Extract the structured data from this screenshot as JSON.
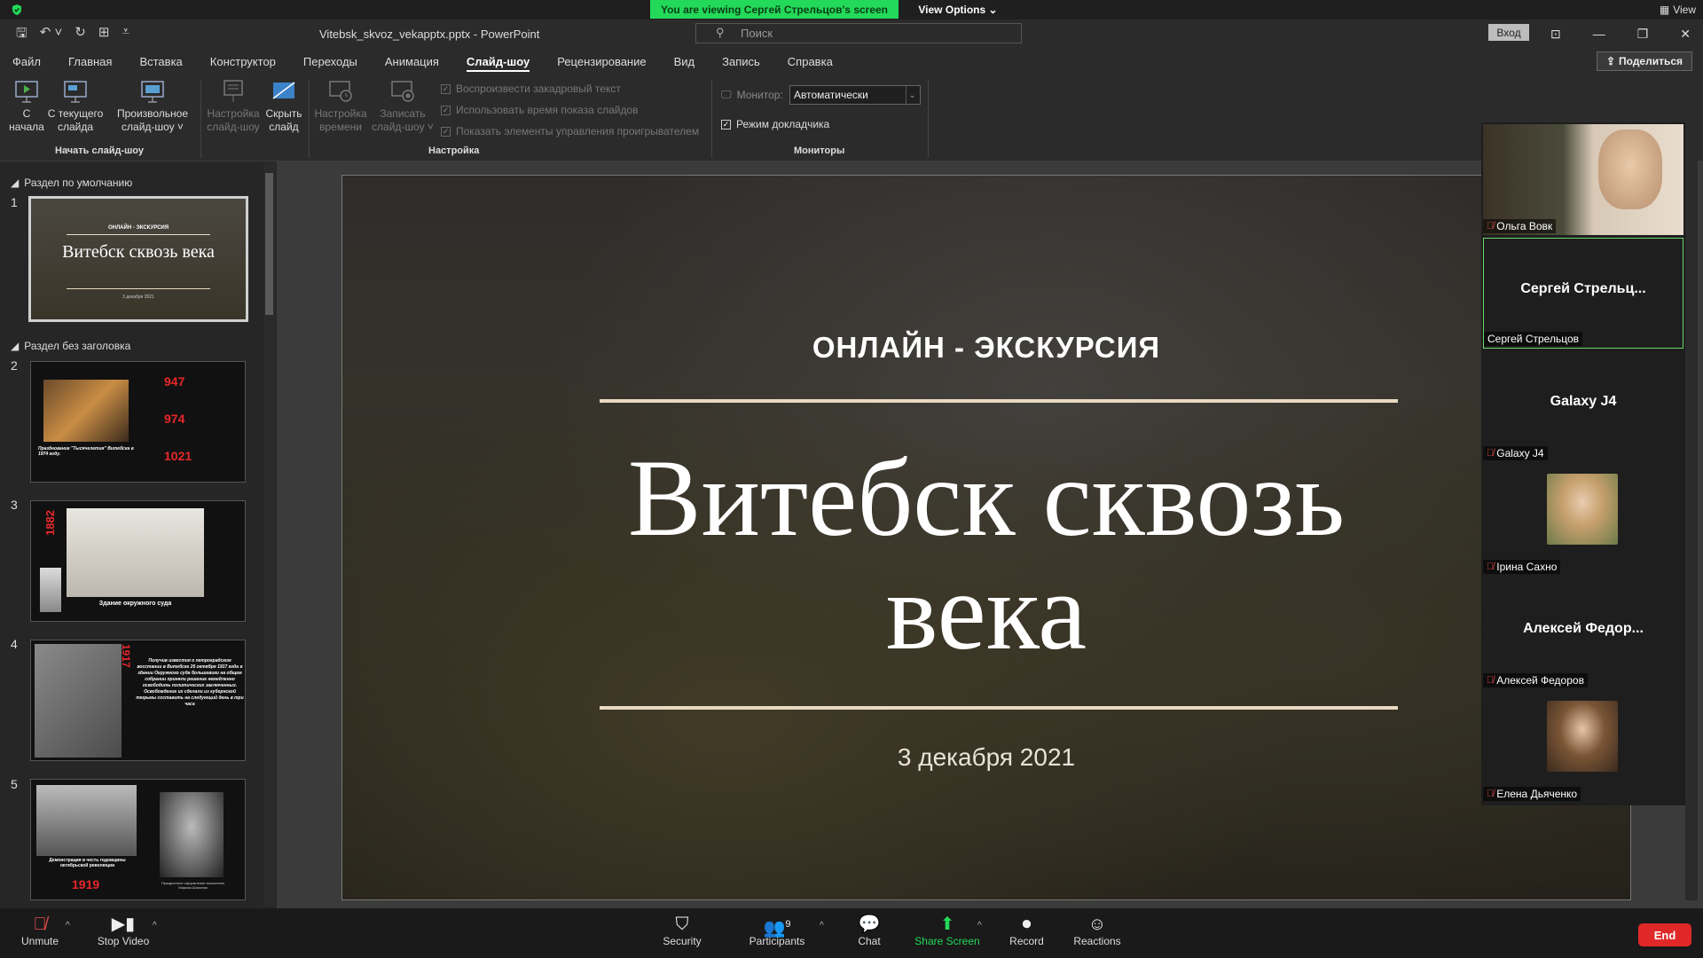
{
  "zoom": {
    "viewing_banner": "You are viewing Сергей Стрельцов's screen",
    "view_options": "View Options",
    "view_label": "View",
    "toolbar": {
      "unmute": "Unmute",
      "stop_video": "Stop Video",
      "security": "Security",
      "participants": "Participants",
      "participants_count": "9",
      "chat": "Chat",
      "share_screen": "Share Screen",
      "record": "Record",
      "reactions": "Reactions",
      "end": "End"
    },
    "participants": [
      {
        "name": "Ольга Вовк",
        "muted": true,
        "video": true
      },
      {
        "name": "Сергей Стрельцов",
        "display": "Сергей  Стрельц...",
        "muted": false,
        "video": false,
        "active": true
      },
      {
        "name": "Galaxy J4",
        "display": "Galaxy J4",
        "muted": true,
        "video": false
      },
      {
        "name": "Ірина Сахно",
        "muted": true,
        "video": true
      },
      {
        "name": "Алексей Федоров",
        "display": "Алексей  Федор...",
        "muted": true,
        "video": false
      },
      {
        "name": "Елена Дьяченко",
        "muted": true,
        "video": true
      }
    ]
  },
  "ppt": {
    "doc_title": "Vitebsk_skvoz_vekapptx.pptx  -  PowerPoint",
    "search_placeholder": "Поиск",
    "login": "Вход",
    "share": "Поделиться",
    "menu": [
      "Файл",
      "Главная",
      "Вставка",
      "Конструктор",
      "Переходы",
      "Анимация",
      "Слайд-шоу",
      "Рецензирование",
      "Вид",
      "Запись",
      "Справка"
    ],
    "active_menu": "Слайд-шоу",
    "ribbon": {
      "from_start": [
        "С",
        "начала"
      ],
      "from_current": [
        "С текущего",
        "слайда"
      ],
      "custom": [
        "Произвольное",
        "слайд-шоу ˅"
      ],
      "setup": [
        "Настройка",
        "слайд-шоу"
      ],
      "hide": [
        "Скрыть",
        "слайд"
      ],
      "rehearse": [
        "Настройка",
        "времени"
      ],
      "record": [
        "Записать",
        "слайд-шоу ˅"
      ],
      "group_start": "Начать слайд-шоу",
      "group_setup": "Настройка",
      "group_monitors": "Мониторы",
      "chk_narration": "Воспроизвести закадровый текст",
      "chk_timings": "Использовать время показа слайдов",
      "chk_controls": "Показать элементы управления проигрывателем",
      "monitor_label": "Монитор:",
      "monitor_value": "Автоматически",
      "presenter_view": "Режим докладчика"
    },
    "sections": {
      "default": "Раздел по умолчанию",
      "untitled": "Раздел без заголовка"
    },
    "thumbnails": [
      {
        "num": "1",
        "kicker": "ОНЛАЙН - ЭКСКУРСИЯ",
        "title": "Витебск сквозь века",
        "date": "3 декабря 2021"
      },
      {
        "num": "2",
        "years": [
          "947",
          "974",
          "1021"
        ],
        "caption": "Празднование \"Тысячелетия\" Витебска в 1974 году."
      },
      {
        "num": "3",
        "year": "1882",
        "caption": "Здание окружного суда"
      },
      {
        "num": "4",
        "year": "1917",
        "text": "Получив известия о петроградском восстании в Витебске 26 октября 1917 года в здании Окружного суда большевики на общем собрании приняли решение немедленно освободить политических заключенных. Освобождение их сделали из губернской тюрьмы составить на следующий день в три часа"
      },
      {
        "num": "5",
        "year": "1919",
        "caption": "Демонстрация в честь годовщины октябрьской революции",
        "caption2": "Праздничное оформление выполнено Марком Шагалом"
      }
    ],
    "slide": {
      "kicker": "ОНЛАЙН - ЭКСКУРСИЯ",
      "title_line1": "Витебск сквозь",
      "title_line2": "века",
      "date": "3 декабря 2021"
    }
  },
  "colors": {
    "zoom_green": "#23d959",
    "end_red": "#e02828",
    "year_red": "#e8272a"
  }
}
